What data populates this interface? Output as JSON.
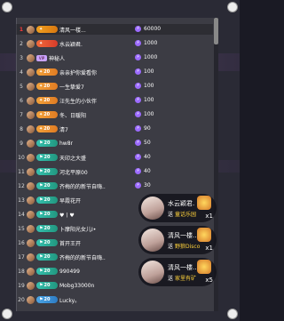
{
  "rows": [
    {
      "rank": "1",
      "level": "",
      "name": "清风一楼...",
      "score": "60000",
      "hl": true,
      "badge_color": "gold",
      "badge_icon": "✦"
    },
    {
      "rank": "2",
      "level": "",
      "name": "水云颖君.",
      "score": "1000",
      "hl": false,
      "badge_color": "red",
      "badge_icon": "✦"
    },
    {
      "rank": "3",
      "level": "",
      "name": "神秘人",
      "score": "1000",
      "hl": false,
      "badge_color": "",
      "badge_icon": ""
    },
    {
      "rank": "4",
      "level": "20",
      "name": "亲亲护你爱看你",
      "score": "100",
      "hl": false,
      "badge_color": "orange",
      "badge_icon": "✦"
    },
    {
      "rank": "5",
      "level": "20",
      "name": "一生挚爱7",
      "score": "100",
      "hl": false,
      "badge_color": "orange",
      "badge_icon": "✦"
    },
    {
      "rank": "6",
      "level": "20",
      "name": "汪先生的小伙伴",
      "score": "100",
      "hl": false,
      "badge_color": "orange",
      "badge_icon": "✦"
    },
    {
      "rank": "7",
      "level": "20",
      "name": "冬、日暖阳",
      "score": "100",
      "hl": false,
      "badge_color": "orange",
      "badge_icon": "✦"
    },
    {
      "rank": "8",
      "level": "20",
      "name": "清7",
      "score": "90",
      "hl": false,
      "badge_color": "orange",
      "badge_icon": "✦"
    },
    {
      "rank": "9",
      "level": "20",
      "name": "hw8r",
      "score": "50",
      "hl": false,
      "badge_color": "teal",
      "badge_icon": "⚑"
    },
    {
      "rank": "10",
      "level": "20",
      "name": "天印之大盛",
      "score": "40",
      "hl": false,
      "badge_color": "teal",
      "badge_icon": "⚑"
    },
    {
      "rank": "11",
      "level": "20",
      "name": "河北平原00",
      "score": "40",
      "hl": false,
      "badge_color": "teal",
      "badge_icon": "⚑"
    },
    {
      "rank": "12",
      "level": "20",
      "name": "齐梅的的新节自嗨..",
      "score": "30",
      "hl": false,
      "badge_color": "teal",
      "badge_icon": "⚑"
    },
    {
      "rank": "13",
      "level": "20",
      "name": "早霞花开",
      "score": "",
      "hl": false,
      "badge_color": "teal",
      "badge_icon": "⚑"
    },
    {
      "rank": "14",
      "level": "20",
      "name": "♥丨♥",
      "score": "",
      "hl": false,
      "badge_color": "teal",
      "badge_icon": "⚑"
    },
    {
      "rank": "15",
      "level": "20",
      "name": "卜摩阳光女儿I•",
      "score": "",
      "hl": false,
      "badge_color": "teal",
      "badge_icon": "⚑"
    },
    {
      "rank": "16",
      "level": "20",
      "name": "首开王开",
      "score": "",
      "hl": false,
      "badge_color": "teal",
      "badge_icon": "⚑"
    },
    {
      "rank": "17",
      "level": "20",
      "name": "齐梅的的新节自嗨..",
      "score": "",
      "hl": false,
      "badge_color": "teal",
      "badge_icon": "⚑"
    },
    {
      "rank": "18",
      "level": "20",
      "name": "990499",
      "score": "",
      "hl": false,
      "badge_color": "teal",
      "badge_icon": "⚑"
    },
    {
      "rank": "19",
      "level": "20",
      "name": "Mobg33000n",
      "score": "",
      "hl": false,
      "badge_color": "teal",
      "badge_icon": "⚑"
    },
    {
      "rank": "20",
      "level": "20",
      "name": "Lucky。",
      "score": "",
      "hl": false,
      "badge_color": "blue",
      "badge_icon": "⚑"
    }
  ],
  "gift_cards": [
    {
      "name": "水云颖君.",
      "prefix": "送",
      "gift": "童话乐园",
      "count": "x1"
    },
    {
      "name": "清风一楼...",
      "prefix": "送",
      "gift": "野狼Disco",
      "count": "x1"
    },
    {
      "name": "清风一楼...",
      "prefix": "送",
      "gift": "家里有矿",
      "count": "x5"
    }
  ],
  "labels": {
    "vip": "VIP"
  }
}
